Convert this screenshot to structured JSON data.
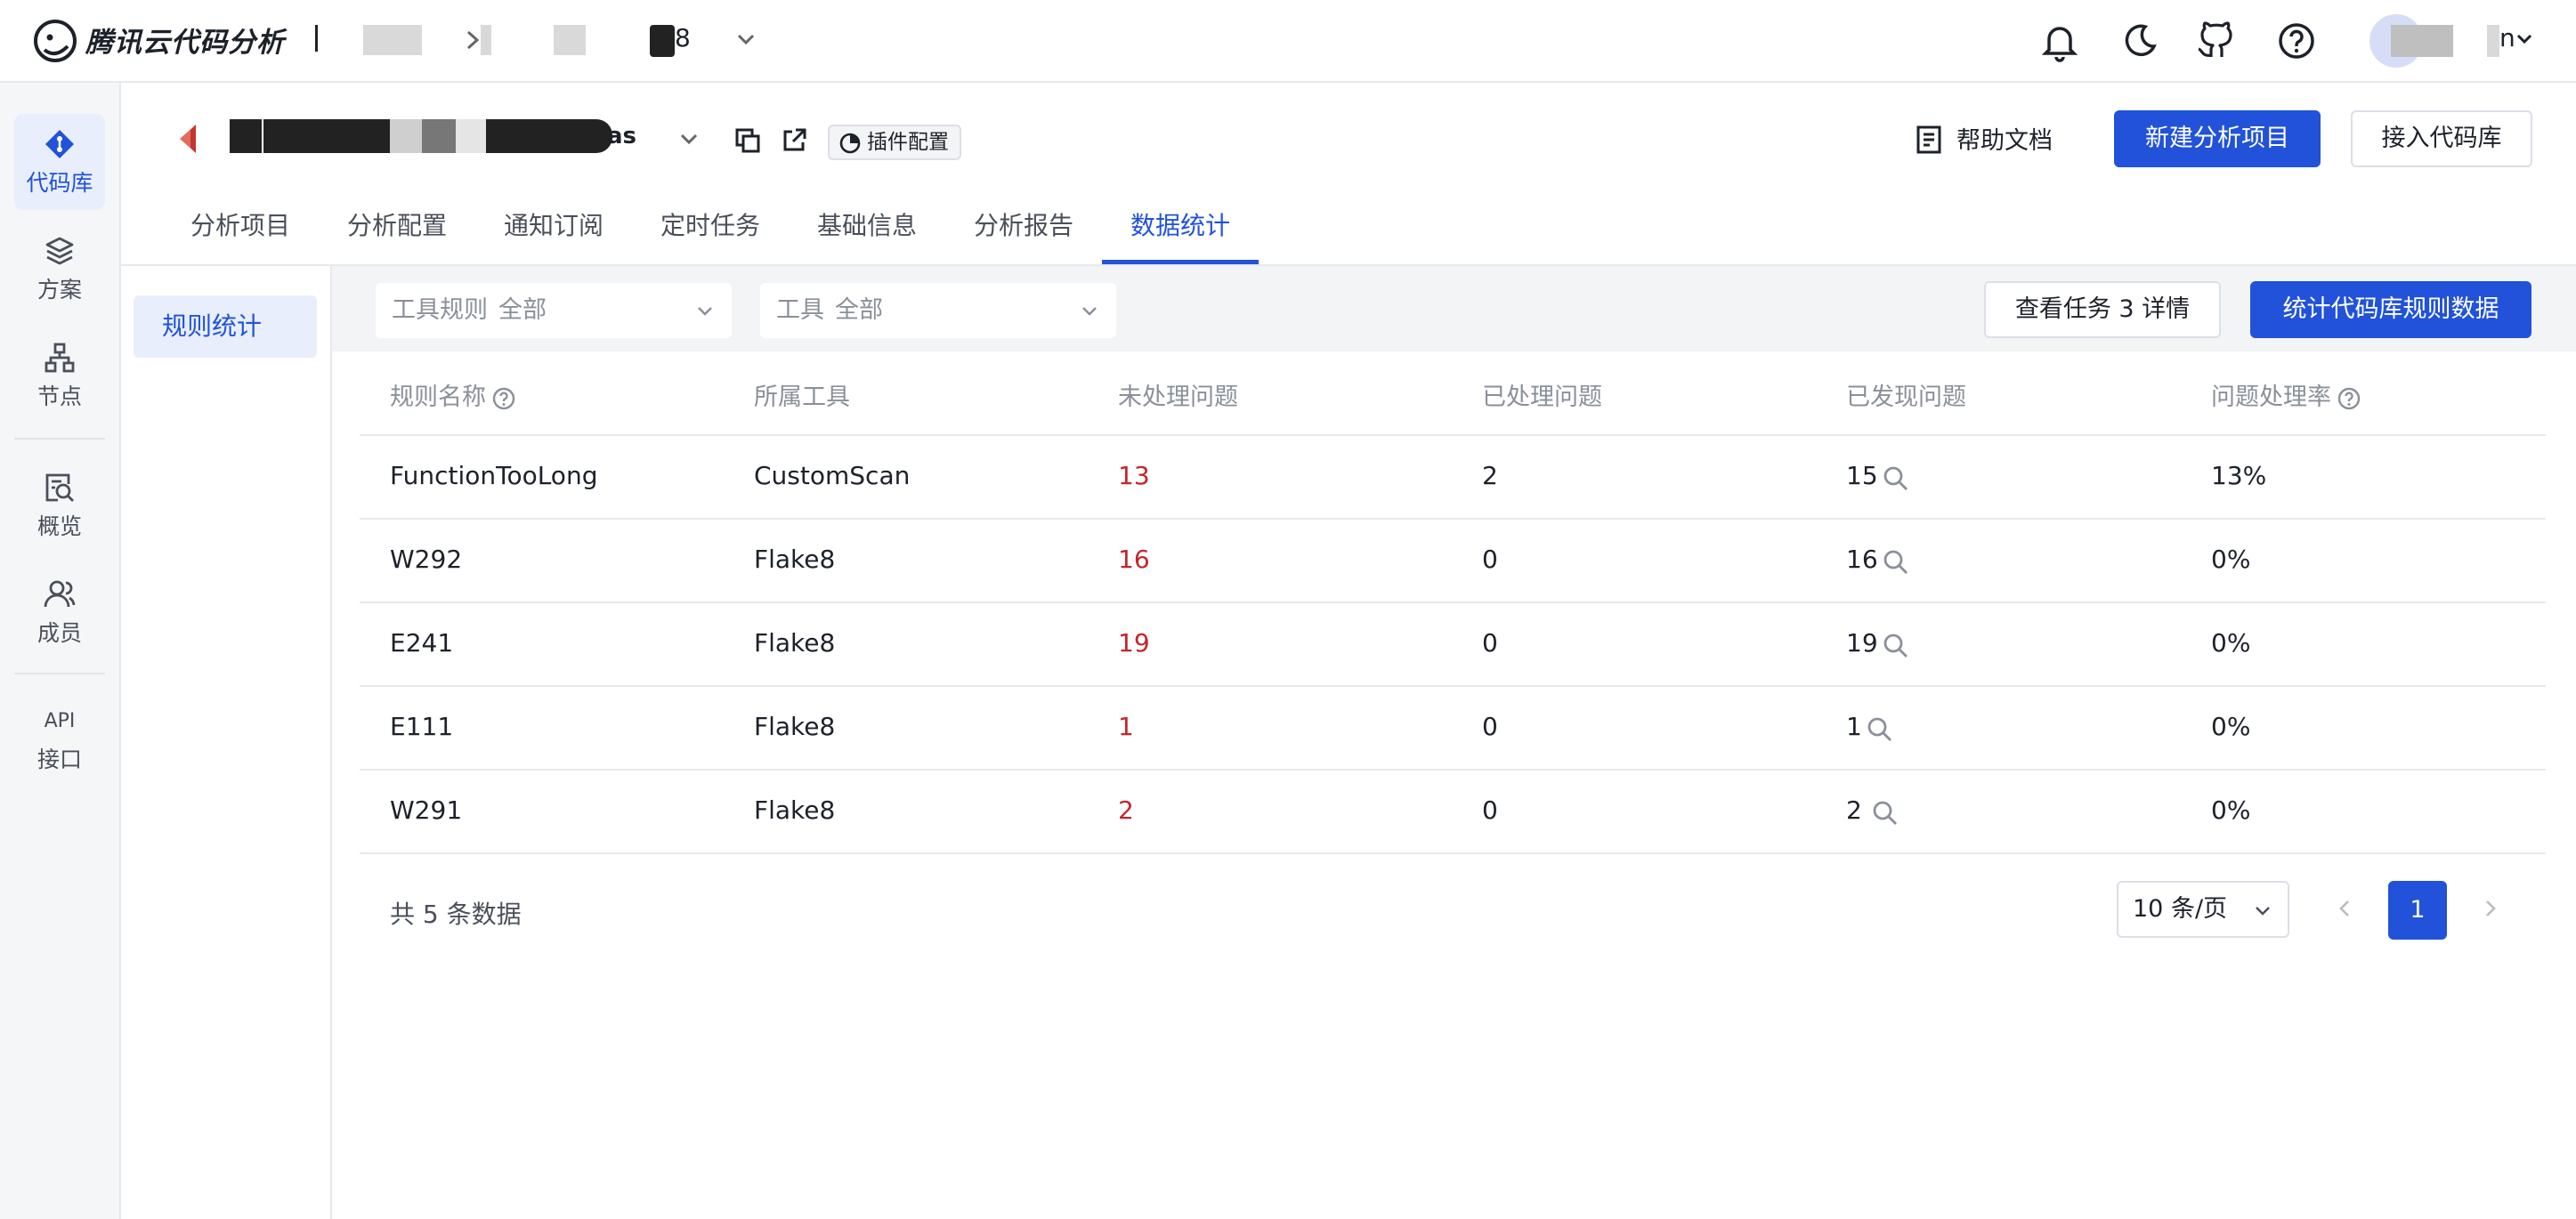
{
  "header": {
    "brand": "腾讯云代码分析",
    "breadcrumb_tail": "8",
    "user_suffix": "n"
  },
  "sidebar": {
    "items": [
      {
        "label": "代码库",
        "icon": "repo-icon"
      },
      {
        "label": "方案",
        "icon": "layers-icon"
      },
      {
        "label": "节点",
        "icon": "node-icon"
      },
      {
        "label": "概览",
        "icon": "overview-icon"
      },
      {
        "label": "成员",
        "icon": "members-icon"
      },
      {
        "label": "接口",
        "icon": "api-icon",
        "top_text": "API"
      }
    ]
  },
  "project": {
    "name_suffix": "as",
    "plugin_label": "插件配置",
    "help_label": "帮助文档",
    "new_analysis_label": "新建分析项目",
    "connect_repo_label": "接入代码库"
  },
  "tabs": [
    "分析项目",
    "分析配置",
    "通知订阅",
    "定时任务",
    "基础信息",
    "分析报告",
    "数据统计"
  ],
  "subnav": {
    "active": "规则统计"
  },
  "filters": {
    "rule": {
      "label": "工具规则",
      "value": "全部"
    },
    "tool": {
      "label": "工具",
      "value": "全部"
    },
    "view_task_label": "查看任务 3 详情",
    "stats_button_label": "统计代码库规则数据"
  },
  "table": {
    "headers": [
      "规则名称",
      "所属工具",
      "未处理问题",
      "已处理问题",
      "已发现问题",
      "问题处理率"
    ],
    "rows": [
      [
        "FunctionTooLong",
        "CustomScan",
        "13",
        "2",
        "15",
        "13%"
      ],
      [
        "W292",
        "Flake8",
        "16",
        "0",
        "16",
        "0%"
      ],
      [
        "E241",
        "Flake8",
        "19",
        "0",
        "19",
        "0%"
      ],
      [
        "E111",
        "Flake8",
        "1",
        "0",
        "1",
        "0%"
      ],
      [
        "W291",
        "Flake8",
        "2",
        "0",
        "2",
        "0%"
      ]
    ]
  },
  "pagination": {
    "total_text": "共 5 条数据",
    "page_size": "10 条/页",
    "current_page": "1"
  },
  "colors": {
    "accent": "#2152d9",
    "unhandled": "#c4252a"
  }
}
